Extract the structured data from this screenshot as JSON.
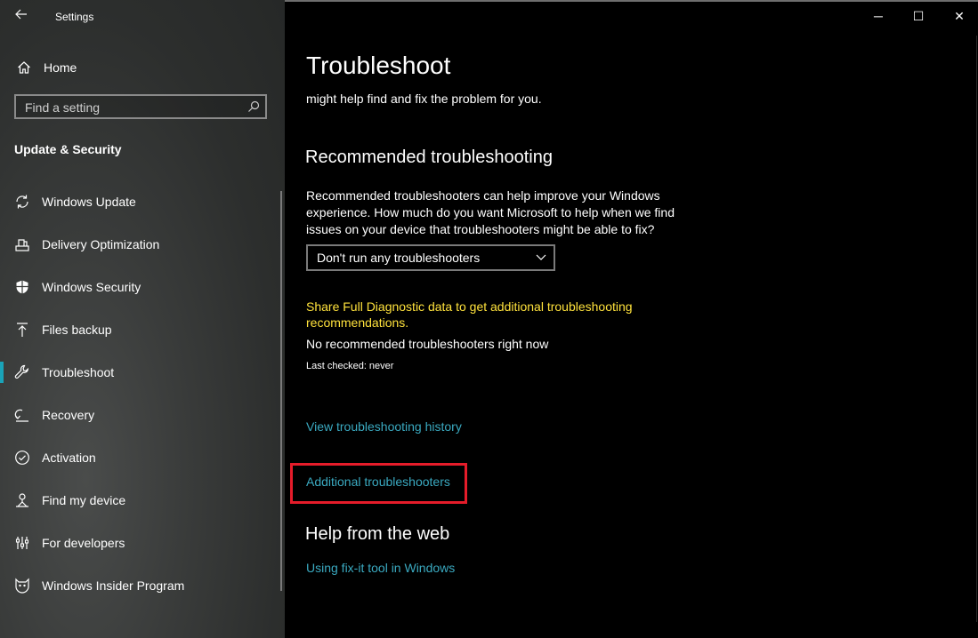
{
  "app": {
    "title": "Settings"
  },
  "sidebar": {
    "home_label": "Home",
    "search_placeholder": "Find a setting",
    "section_title": "Update & Security",
    "items": [
      {
        "label": "Windows Update",
        "icon": "sync-icon"
      },
      {
        "label": "Delivery Optimization",
        "icon": "delivery-optimization-icon"
      },
      {
        "label": "Windows Security",
        "icon": "shield-icon"
      },
      {
        "label": "Files backup",
        "icon": "backup-arrow-icon"
      },
      {
        "label": "Troubleshoot",
        "icon": "wrench-icon",
        "active": true
      },
      {
        "label": "Recovery",
        "icon": "recovery-icon"
      },
      {
        "label": "Activation",
        "icon": "check-circle-icon"
      },
      {
        "label": "Find my device",
        "icon": "find-device-icon"
      },
      {
        "label": "For developers",
        "icon": "developer-icon"
      },
      {
        "label": "Windows Insider Program",
        "icon": "insider-cat-icon"
      }
    ]
  },
  "window_controls": {
    "minimize": "─",
    "maximize": "☐",
    "close": "✕"
  },
  "main": {
    "title": "Troubleshoot",
    "clipped_intro": "might help find and fix the problem for you.",
    "recommended": {
      "heading": "Recommended troubleshooting",
      "description": "Recommended troubleshooters can help improve your Windows experience. How much do you want Microsoft to help when we find issues on your device that troubleshooters might be able to fix?",
      "dropdown_value": "Don't run any troubleshooters",
      "diagnostic_link": "Share Full Diagnostic data to get additional troubleshooting recommendations.",
      "status": "No recommended troubleshooters right now",
      "last_checked": "Last checked: never"
    },
    "history_link": "View troubleshooting history",
    "additional_link": "Additional troubleshooters",
    "help_heading": "Help from the web",
    "fixit_link": "Using fix-it tool in Windows"
  },
  "colors": {
    "accent": "#1aa3b8",
    "link": "#3aa9c0",
    "warning_text": "#ffe23c",
    "highlight": "#e51c2a"
  }
}
